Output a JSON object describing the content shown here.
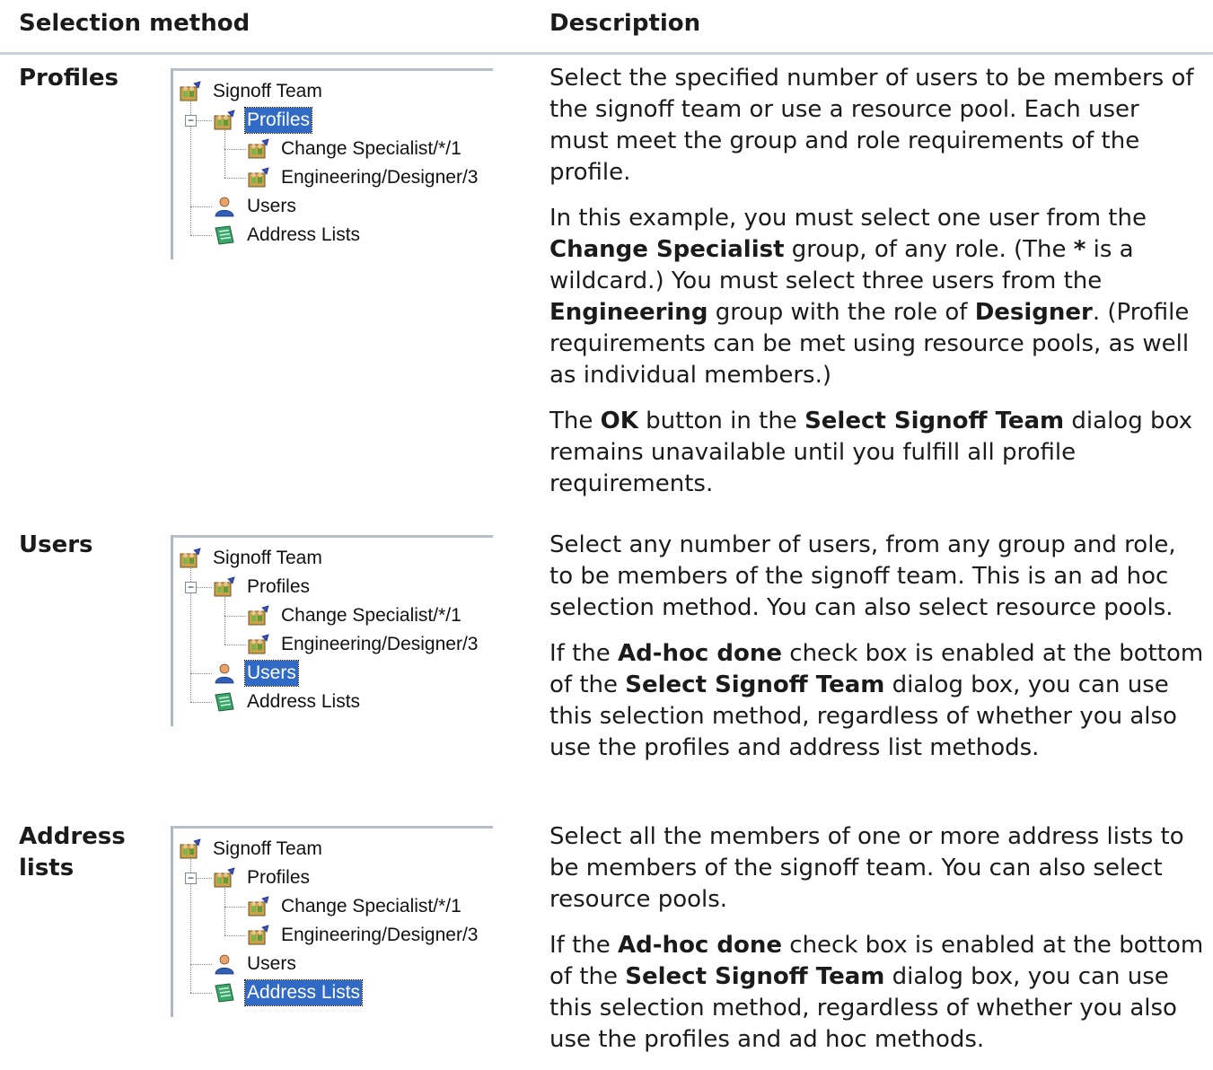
{
  "header": {
    "col1": "Selection method",
    "col2": "Description"
  },
  "rows": [
    {
      "method": "Profiles",
      "tree": {
        "root": "Signoff Team",
        "profiles": "Profiles",
        "profile1": "Change Specialist/*/1",
        "profile2": "Engineering/Designer/3",
        "users": "Users",
        "address_lists": "Address Lists",
        "selected": "profiles"
      },
      "paragraphs": [
        [
          {
            "t": "Select the specified number of users to be members of the signoff team or use a resource pool. Each user must meet the group and role requirements of the profile."
          }
        ],
        [
          {
            "t": "In this example, you must select one user from the "
          },
          {
            "t": "Change Specialist",
            "b": true
          },
          {
            "t": " group, of any role. (The "
          },
          {
            "t": "*",
            "b": true
          },
          {
            "t": " is a wildcard.) You must select three users from the "
          },
          {
            "t": "Engineering",
            "b": true
          },
          {
            "t": " group with the role of "
          },
          {
            "t": "Designer",
            "b": true
          },
          {
            "t": ". (Profile requirements can be met using resource pools, as well as individual members.)"
          }
        ],
        [
          {
            "t": "The "
          },
          {
            "t": "OK",
            "b": true
          },
          {
            "t": " button in the "
          },
          {
            "t": "Select Signoff Team",
            "b": true
          },
          {
            "t": " dialog box remains unavailable until you fulfill all profile requirements."
          }
        ]
      ]
    },
    {
      "method": "Users",
      "tree": {
        "root": "Signoff Team",
        "profiles": "Profiles",
        "profile1": "Change Specialist/*/1",
        "profile2": "Engineering/Designer/3",
        "users": "Users",
        "address_lists": "Address Lists",
        "selected": "users"
      },
      "paragraphs": [
        [
          {
            "t": "Select any number of users, from any group and role, to be members of the signoff team. This is an ad hoc selection method. You can also select resource pools."
          }
        ],
        [
          {
            "t": "If the "
          },
          {
            "t": "Ad-hoc done",
            "b": true
          },
          {
            "t": " check box is enabled at the bottom of the "
          },
          {
            "t": "Select Signoff Team",
            "b": true
          },
          {
            "t": " dialog box, you can use this selection method, regardless of whether you also use the profiles and address list methods."
          }
        ]
      ]
    },
    {
      "method": "Address lists",
      "tree": {
        "root": "Signoff Team",
        "profiles": "Profiles",
        "profile1": "Change Specialist/*/1",
        "profile2": "Engineering/Designer/3",
        "users": "Users",
        "address_lists": "Address Lists",
        "selected": "address_lists"
      },
      "paragraphs": [
        [
          {
            "t": "Select all the members of one or more address lists to be members of the signoff team. You can also select resource pools."
          }
        ],
        [
          {
            "t": "If the "
          },
          {
            "t": "Ad-hoc done",
            "b": true
          },
          {
            "t": " check box is enabled at the bottom of the "
          },
          {
            "t": "Select Signoff Team",
            "b": true
          },
          {
            "t": " dialog box, you can use this selection method, regardless of whether you also use the profiles and ad hoc methods."
          }
        ]
      ]
    }
  ],
  "colors": {
    "selection": "#316ac5",
    "rule": "#c9d2d9"
  },
  "icons": {
    "team": "team-icon",
    "user": "user-icon",
    "address_list": "address-list-icon"
  }
}
